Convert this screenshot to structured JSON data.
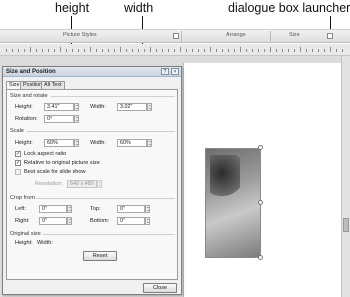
{
  "callouts": {
    "height": "height",
    "width": "width",
    "launcher": "dialogue box launcher"
  },
  "ribbon": {
    "groups": [
      "Picture Styles",
      "Arrange",
      "Size"
    ]
  },
  "dialog": {
    "title": "Size and Position",
    "help_label": "?",
    "close_label": "×",
    "tabs": [
      "Size",
      "Position",
      "Alt Text"
    ],
    "active_tab": "Size",
    "size_rotate": {
      "section": "Size and rotate",
      "height_label": "Height:",
      "height_value": "3.41\"",
      "width_label": "Width:",
      "width_value": "3.02\"",
      "rotation_label": "Rotation:",
      "rotation_value": "0°"
    },
    "scale": {
      "section": "Scale",
      "height_label": "Height:",
      "height_value": "60%",
      "width_label": "Width:",
      "width_value": "60%",
      "lock_aspect": "Lock aspect ratio",
      "lock_aspect_checked": true,
      "relative_original": "Relative to original picture size",
      "relative_original_checked": true,
      "best_scale": "Best scale for slide show",
      "best_scale_checked": false,
      "resolution_label": "Resolution:",
      "resolution_value": "640 x 480"
    },
    "crop_from": {
      "section": "Crop from",
      "left_label": "Left:",
      "left_value": "0\"",
      "top_label": "Top:",
      "top_value": "0\"",
      "right_label": "Right:",
      "right_value": "0\"",
      "bottom_label": "Bottom:",
      "bottom_value": "0\""
    },
    "original_size": {
      "section": "Original size",
      "height_label": "Height:",
      "width_label": "Width:",
      "reset_label": "Reset"
    },
    "close_button": "Close"
  }
}
